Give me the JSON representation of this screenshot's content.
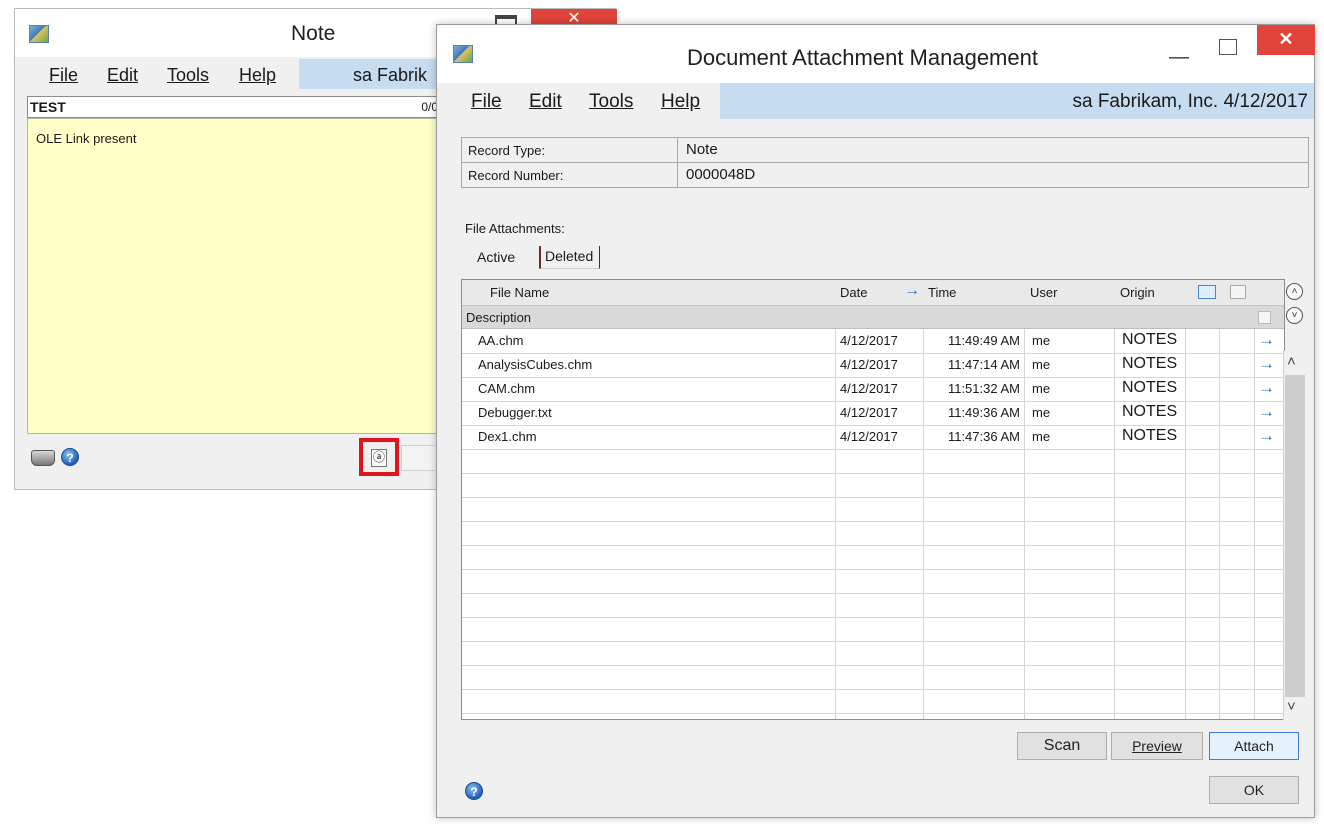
{
  "note_window": {
    "title": "Note",
    "menu": [
      "File",
      "Edit",
      "Tools",
      "Help"
    ],
    "company": "sa  Fabrik",
    "header_title": "TEST",
    "counter": "0/0",
    "body_text": "OLE Link present",
    "attach_icon_glyph": "ⓐ"
  },
  "dam_window": {
    "title": "Document Attachment Management",
    "menu": [
      "File",
      "Edit",
      "Tools",
      "Help"
    ],
    "company": "sa  Fabrikam, Inc.  4/12/2017",
    "record_type_label": "Record Type:",
    "record_type_value": "Note",
    "record_number_label": "Record Number:",
    "record_number_value": "0000048D",
    "file_attachments_label": "File Attachments:",
    "tabs": [
      "Active",
      "Deleted"
    ],
    "columns": {
      "file_name": "File Name",
      "date": "Date",
      "time": "Time",
      "user": "User",
      "origin": "Origin",
      "description": "Description"
    },
    "rows": [
      {
        "file_name": "AA.chm",
        "date": "4/12/2017",
        "time": "11:49:49 AM",
        "user": "me",
        "origin": "NOTES"
      },
      {
        "file_name": "AnalysisCubes.chm",
        "date": "4/12/2017",
        "time": "11:47:14 AM",
        "user": "me",
        "origin": "NOTES"
      },
      {
        "file_name": "CAM.chm",
        "date": "4/12/2017",
        "time": "11:51:32 AM",
        "user": "me",
        "origin": "NOTES"
      },
      {
        "file_name": "Debugger.txt",
        "date": "4/12/2017",
        "time": "11:49:36 AM",
        "user": "me",
        "origin": "NOTES"
      },
      {
        "file_name": "Dex1.chm",
        "date": "4/12/2017",
        "time": "11:47:36 AM",
        "user": "me",
        "origin": "NOTES"
      }
    ],
    "buttons": {
      "scan": "Scan",
      "preview": "Preview",
      "attach": "Attach",
      "ok": "OK"
    }
  },
  "icons": {
    "close": "✕",
    "minimize": "—",
    "help": "?",
    "row_arrow": "→",
    "sort_arrow": "→",
    "scroll_up": "˄",
    "scroll_down": "˅",
    "collapse": "˄",
    "expand": "˅"
  },
  "colors": {
    "note_body": "#ffffc8",
    "close_button": "#e0443a",
    "menu_company_strip": "#c6dcf1",
    "highlight_box": "#e0141e",
    "row_arrow": "#1f6fd6"
  }
}
